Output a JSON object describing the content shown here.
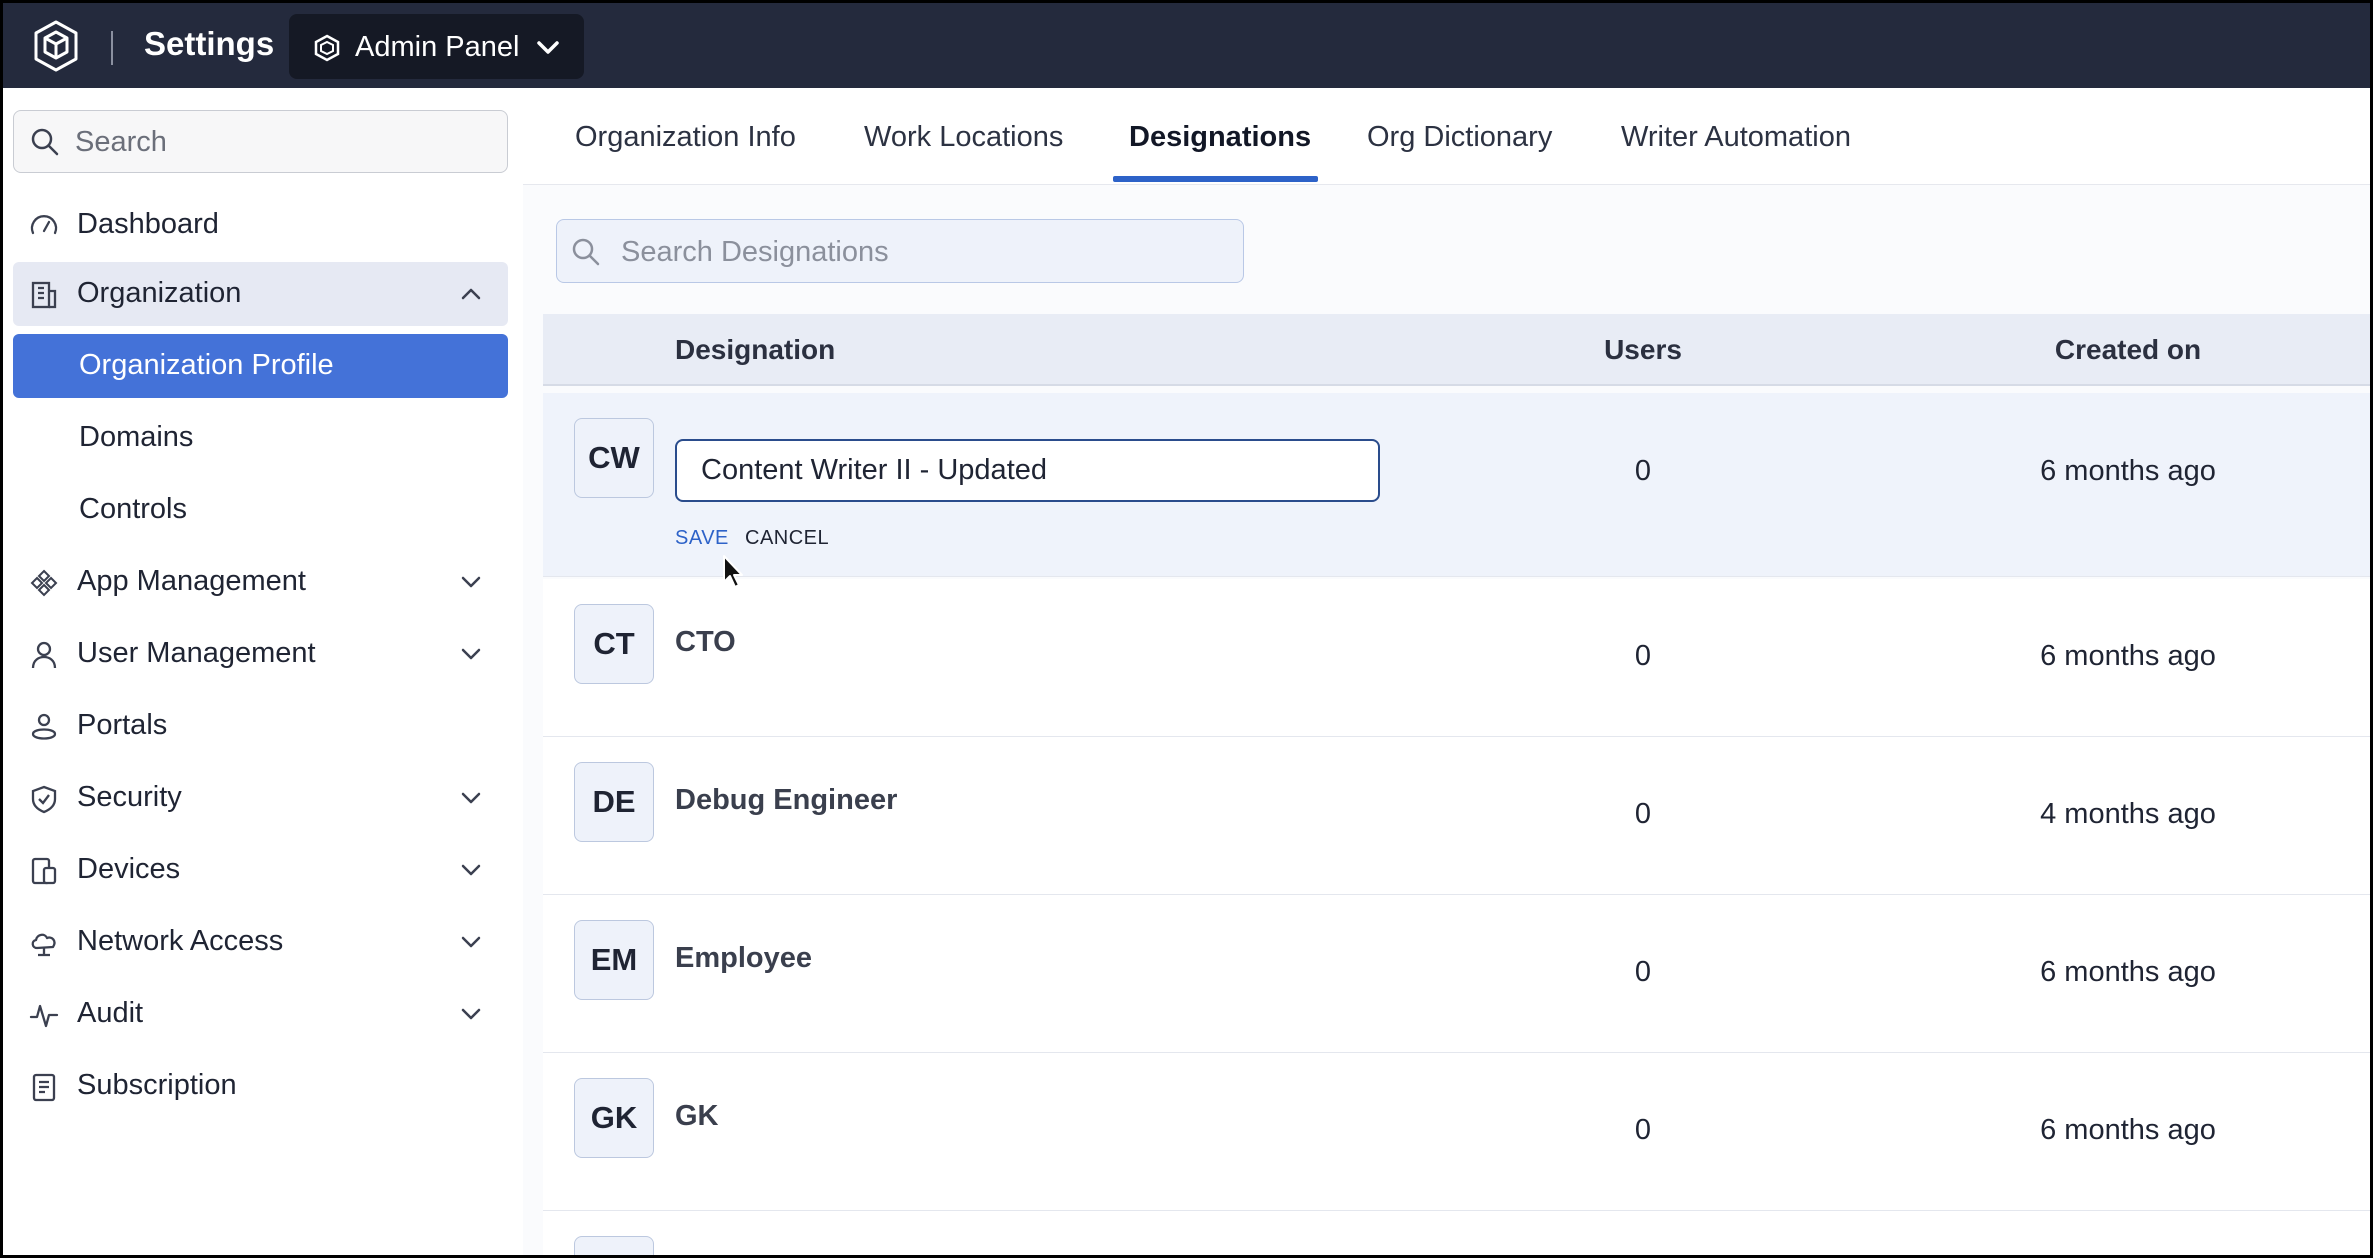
{
  "header": {
    "app_title": "Settings",
    "panel_select": "Admin Panel",
    "colors": {
      "bar": "#242a3d",
      "accent": "#4472d8"
    }
  },
  "sidebar": {
    "search_placeholder": "Search",
    "items": [
      {
        "label": "Dashboard",
        "icon": "gauge-icon"
      },
      {
        "label": "Organization",
        "icon": "building-icon",
        "expanded": true
      },
      {
        "label": "Organization Profile",
        "active": true
      },
      {
        "label": "Domains"
      },
      {
        "label": "Controls"
      },
      {
        "label": "App Management",
        "icon": "apps-icon"
      },
      {
        "label": "User Management",
        "icon": "user-icon"
      },
      {
        "label": "Portals",
        "icon": "portal-icon"
      },
      {
        "label": "Security",
        "icon": "shield-icon"
      },
      {
        "label": "Devices",
        "icon": "devices-icon"
      },
      {
        "label": "Network Access",
        "icon": "cloud-icon"
      },
      {
        "label": "Audit",
        "icon": "pulse-icon"
      },
      {
        "label": "Subscription",
        "icon": "receipt-icon"
      }
    ]
  },
  "tabs": [
    {
      "label": "Organization Info"
    },
    {
      "label": "Work Locations"
    },
    {
      "label": "Designations",
      "active": true
    },
    {
      "label": "Org Dictionary"
    },
    {
      "label": "Writer Automation"
    }
  ],
  "designations": {
    "search_placeholder": "Search Designations",
    "columns": {
      "designation": "Designation",
      "users": "Users",
      "created": "Created on"
    },
    "editing": {
      "initials": "CW",
      "value": "Content Writer II - Updated",
      "users": "0",
      "created": "6 months ago",
      "save_label": "SAVE",
      "cancel_label": "CANCEL"
    },
    "rows": [
      {
        "initials": "CT",
        "name": "CTO",
        "users": "0",
        "created": "6 months ago"
      },
      {
        "initials": "DE",
        "name": "Debug Engineer",
        "users": "0",
        "created": "4 months ago"
      },
      {
        "initials": "EM",
        "name": "Employee",
        "users": "0",
        "created": "6 months ago"
      },
      {
        "initials": "GK",
        "name": "GK",
        "users": "0",
        "created": "6 months ago"
      }
    ]
  }
}
